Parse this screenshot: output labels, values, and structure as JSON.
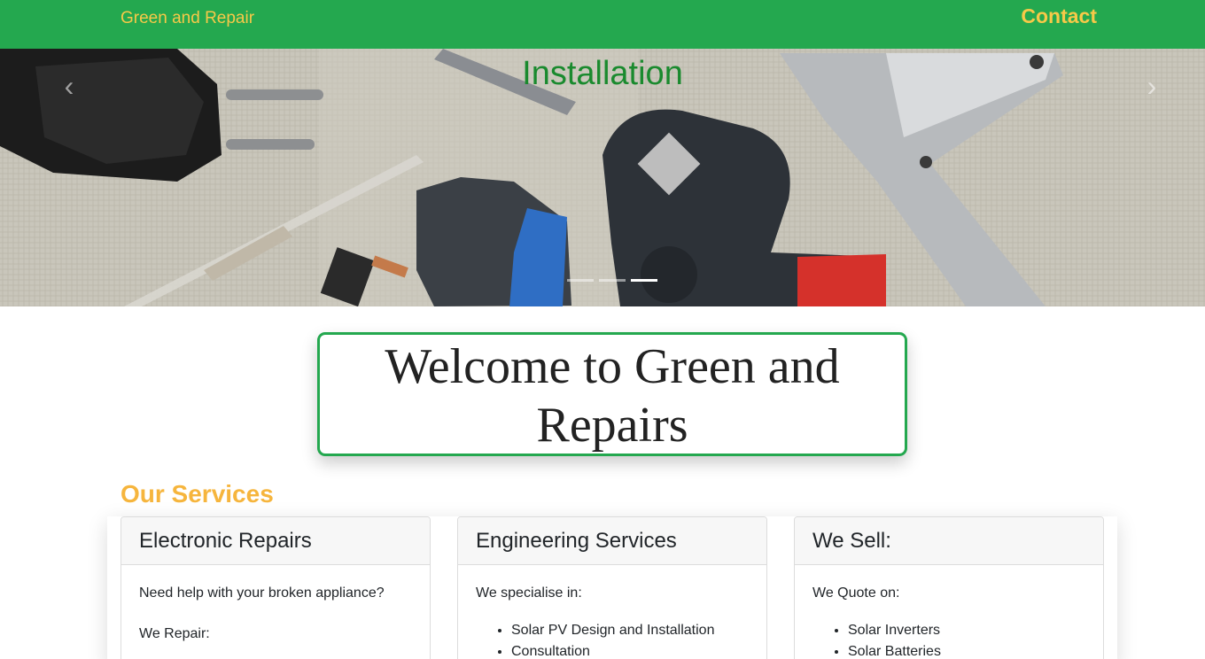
{
  "navbar": {
    "brand": "Green and Repair",
    "contact": "Contact"
  },
  "carousel": {
    "caption": "Installation",
    "prev_icon": "chevron-left-icon",
    "next_icon": "chevron-right-icon",
    "slide_count": 3,
    "active_slide": 3
  },
  "welcome": {
    "title": "Welcome to Green and Repairs"
  },
  "services": {
    "title": "Our Services",
    "cards": [
      {
        "title": "Electronic Repairs",
        "intro": "Need help with your broken appliance?",
        "subhead": "We Repair:"
      },
      {
        "title": "Engineering Services",
        "intro": "We specialise in:",
        "items": [
          "Solar PV Design and Installation",
          "Consultation"
        ]
      },
      {
        "title": "We Sell:",
        "intro": "We Quote on:",
        "items": [
          "Solar Inverters",
          "Solar Batteries"
        ]
      }
    ]
  },
  "colors": {
    "nav_green": "#24a84f",
    "accent_yellow": "#f7c948",
    "services_orange": "#f6b53d",
    "caption_green": "#1a8a2e"
  }
}
